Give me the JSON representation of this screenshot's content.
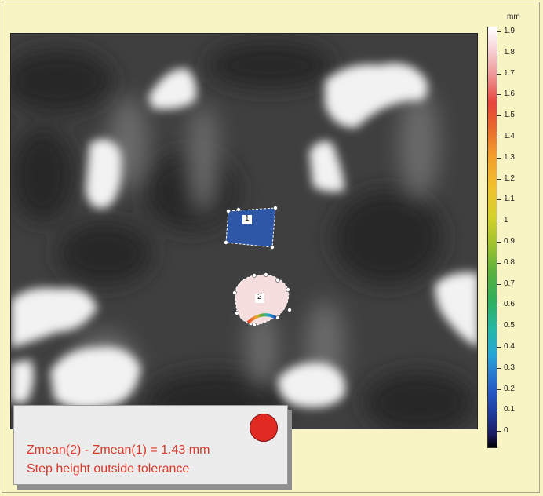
{
  "colorbar": {
    "unit": "mm",
    "ticks": [
      "1.9",
      "1.8",
      "1.7",
      "1.6",
      "1.5",
      "1.4",
      "1.3",
      "1.2",
      "1.1",
      "1",
      "0.9",
      "0.8",
      "0.7",
      "0.6",
      "0.5",
      "0.4",
      "0.3",
      "0.2",
      "0.1",
      "0"
    ]
  },
  "regions": [
    {
      "label": "1",
      "fill": "#2f57a8"
    },
    {
      "label": "2",
      "fill": "#f7dede"
    }
  ],
  "result": {
    "line1": "Zmean(2) - Zmean(1) = 1.43 mm",
    "line2": "Step height outside tolerance",
    "status_color": "#e02a22"
  }
}
